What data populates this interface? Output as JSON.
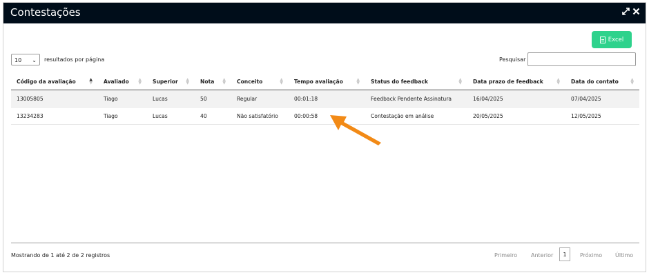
{
  "modal": {
    "title": "Contestações",
    "expand_icon": "expand-icon",
    "close_icon": "close-icon"
  },
  "toolbar": {
    "excel_label": "Excel"
  },
  "length_menu": {
    "value": "10",
    "suffix": "resultados por página"
  },
  "search": {
    "label": "Pesquisar",
    "value": ""
  },
  "table": {
    "columns": [
      "Código da avaliação",
      "Avaliado",
      "Superior",
      "Nota",
      "Conceito",
      "Tempo avaliação",
      "Status do feedback",
      "Data prazo de feedback",
      "Data do contato"
    ],
    "rows": [
      [
        "13005805",
        "Tiago",
        "Lucas",
        "50",
        "Regular",
        "00:01:18",
        "Feedback Pendente Assinatura",
        "16/04/2025",
        "07/04/2025"
      ],
      [
        "13234283",
        "Tiago",
        "Lucas",
        "40",
        "Não satisfatório",
        "00:00:58",
        "Contestação em análise",
        "20/05/2025",
        "12/05/2025"
      ]
    ]
  },
  "footer": {
    "info": "Mostrando de 1 até 2 de 2 registros",
    "pagination": {
      "first": "Primeiro",
      "previous": "Anterior",
      "current": "1",
      "next": "Próximo",
      "last": "Último"
    }
  },
  "colors": {
    "header_bg": "#000d1a",
    "excel_bg": "#2ed28c",
    "arrow": "#f28a16"
  }
}
